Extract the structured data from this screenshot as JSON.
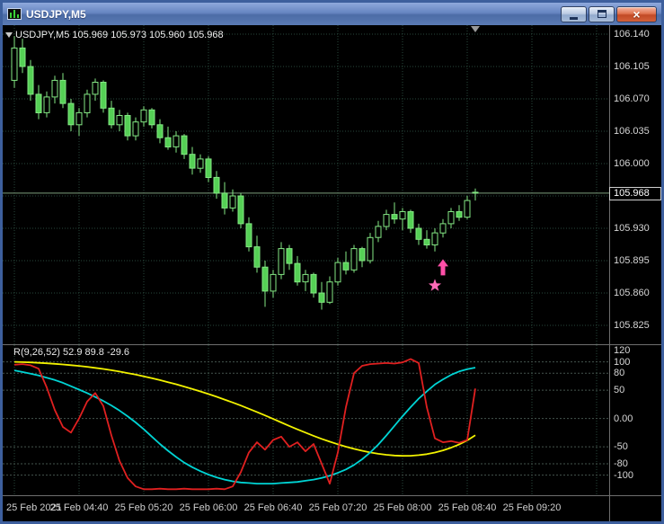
{
  "window": {
    "title": "USDJPY,M5",
    "close_glyph": "×"
  },
  "colors": {
    "background": "#000000",
    "grid": "#29493b",
    "level_line": "#45544d",
    "candle_border": "#84e884",
    "bull_fill": "#000000",
    "bear_fill": "#55d055",
    "price_line": "#7e9e7e",
    "axis_text": "#d6d6d6",
    "shift_marker": "#9a9a9a"
  },
  "chart_data": {
    "type": "candlestick",
    "symbol": "USDJPY",
    "timeframe": "M5",
    "ohlc_header": "USDJPY,M5 105.969 105.973 105.960 105.968",
    "open": 105.969,
    "high": 105.973,
    "low": 105.96,
    "close": 105.968,
    "current_price": 105.968,
    "price_tag": "105.968",
    "price_axis": {
      "max": 106.14,
      "min": 105.805,
      "step": 0.035,
      "labels": [
        {
          "value": 106.14,
          "text": "106.140"
        },
        {
          "value": 106.105,
          "text": "106.105"
        },
        {
          "value": 106.07,
          "text": "106.070"
        },
        {
          "value": 106.035,
          "text": "106.035"
        },
        {
          "value": 106.0,
          "text": "106.000"
        },
        {
          "value": 105.93,
          "text": "105.930"
        },
        {
          "value": 105.895,
          "text": "105.895"
        },
        {
          "value": 105.86,
          "text": "105.860"
        },
        {
          "value": 105.825,
          "text": "105.825"
        }
      ],
      "grid_levels": [
        106.14,
        106.105,
        106.07,
        106.035,
        106.0,
        105.965,
        105.93,
        105.895,
        105.86,
        105.825
      ]
    },
    "time_axis": {
      "labels": [
        {
          "bar": 0,
          "text": "25 Feb 2021"
        },
        {
          "bar": 8,
          "text": "25 Feb 04:40"
        },
        {
          "bar": 16,
          "text": "25 Feb 05:20"
        },
        {
          "bar": 24,
          "text": "25 Feb 06:00"
        },
        {
          "bar": 32,
          "text": "25 Feb 06:40"
        },
        {
          "bar": 40,
          "text": "25 Feb 07:20"
        },
        {
          "bar": 48,
          "text": "25 Feb 08:00"
        },
        {
          "bar": 56,
          "text": "25 Feb 08:40"
        },
        {
          "bar": 64,
          "text": "25 Feb 09:20"
        }
      ],
      "grid_bars": [
        0,
        8,
        16,
        24,
        32,
        40,
        48,
        56,
        64,
        72
      ]
    },
    "candles": [
      [
        106.09,
        106.138,
        106.082,
        106.125
      ],
      [
        106.125,
        106.135,
        106.098,
        106.105
      ],
      [
        106.105,
        106.112,
        106.068,
        106.075
      ],
      [
        106.075,
        106.085,
        106.048,
        106.055
      ],
      [
        106.055,
        106.078,
        106.05,
        106.072
      ],
      [
        106.072,
        106.095,
        106.065,
        106.09
      ],
      [
        106.09,
        106.098,
        106.06,
        106.065
      ],
      [
        106.065,
        106.07,
        106.035,
        106.042
      ],
      [
        106.042,
        106.06,
        106.03,
        106.055
      ],
      [
        106.055,
        106.08,
        106.05,
        106.075
      ],
      [
        106.075,
        106.092,
        106.068,
        106.088
      ],
      [
        106.088,
        106.09,
        106.055,
        106.06
      ],
      [
        106.06,
        106.068,
        106.038,
        106.042
      ],
      [
        106.042,
        106.058,
        106.035,
        106.052
      ],
      [
        106.052,
        106.055,
        106.025,
        106.03
      ],
      [
        106.03,
        106.05,
        106.025,
        106.045
      ],
      [
        106.045,
        106.062,
        106.04,
        106.058
      ],
      [
        106.058,
        106.06,
        106.038,
        106.042
      ],
      [
        106.042,
        106.048,
        106.022,
        106.028
      ],
      [
        106.028,
        106.04,
        106.015,
        106.018
      ],
      [
        106.018,
        106.035,
        106.012,
        106.03
      ],
      [
        106.03,
        106.032,
        106.005,
        106.01
      ],
      [
        106.01,
        106.018,
        105.988,
        105.995
      ],
      [
        105.995,
        106.01,
        105.99,
        106.005
      ],
      [
        106.005,
        106.008,
        105.98,
        105.985
      ],
      [
        105.985,
        105.992,
        105.962,
        105.968
      ],
      [
        105.968,
        105.98,
        105.945,
        105.952
      ],
      [
        105.952,
        105.972,
        105.948,
        105.965
      ],
      [
        105.965,
        105.968,
        105.93,
        105.935
      ],
      [
        105.935,
        105.942,
        105.905,
        105.91
      ],
      [
        105.91,
        105.922,
        105.882,
        105.888
      ],
      [
        105.888,
        105.895,
        105.845,
        105.862
      ],
      [
        105.862,
        105.885,
        105.855,
        105.88
      ],
      [
        105.88,
        105.915,
        105.875,
        105.908
      ],
      [
        105.908,
        105.912,
        105.885,
        105.892
      ],
      [
        105.892,
        105.9,
        105.868,
        105.872
      ],
      [
        105.872,
        105.885,
        105.862,
        105.88
      ],
      [
        105.88,
        105.882,
        105.855,
        105.86
      ],
      [
        105.86,
        105.872,
        105.842,
        105.85
      ],
      [
        105.85,
        105.878,
        105.848,
        105.872
      ],
      [
        105.872,
        105.898,
        105.868,
        105.893
      ],
      [
        105.893,
        105.905,
        105.88,
        105.885
      ],
      [
        105.885,
        105.912,
        105.882,
        105.908
      ],
      [
        105.908,
        105.91,
        105.888,
        105.895
      ],
      [
        105.895,
        105.925,
        105.892,
        105.92
      ],
      [
        105.92,
        105.938,
        105.915,
        105.932
      ],
      [
        105.932,
        105.95,
        105.928,
        105.945
      ],
      [
        105.945,
        105.958,
        105.935,
        105.94
      ],
      [
        105.94,
        105.952,
        105.928,
        105.948
      ],
      [
        105.948,
        105.95,
        105.925,
        105.93
      ],
      [
        105.93,
        105.935,
        105.912,
        105.918
      ],
      [
        105.918,
        105.928,
        105.908,
        105.912
      ],
      [
        105.912,
        105.93,
        105.905,
        105.925
      ],
      [
        105.925,
        105.94,
        105.92,
        105.935
      ],
      [
        105.935,
        105.952,
        105.93,
        105.948
      ],
      [
        105.948,
        105.955,
        105.938,
        105.942
      ],
      [
        105.942,
        105.965,
        105.94,
        105.96
      ],
      [
        105.969,
        105.973,
        105.96,
        105.968
      ]
    ],
    "markers": [
      {
        "type": "arrow-up",
        "bar": 53,
        "price": 105.88,
        "color": "#ff4fa8",
        "name": "buy-arrow-marker"
      },
      {
        "type": "star",
        "bar": 52,
        "price": 105.868,
        "color": "#ff6ab8",
        "name": "star-marker"
      }
    ],
    "indicator": {
      "header": "R(9,26,52) 52.9 89.8 -29.6",
      "name": "R",
      "params": [
        9,
        26,
        52
      ],
      "current_values": [
        52.9,
        89.8,
        -29.6
      ],
      "axis": {
        "labels": [
          {
            "value": 120,
            "text": "120"
          },
          {
            "value": 100,
            "text": "100"
          },
          {
            "value": 80,
            "text": "80"
          },
          {
            "value": 50,
            "text": "50"
          },
          {
            "value": 0,
            "text": "0.00"
          },
          {
            "value": -50,
            "text": "-50"
          },
          {
            "value": -80,
            "text": "-80"
          },
          {
            "value": -100,
            "text": "-100"
          }
        ],
        "level_lines": [
          100,
          80,
          50,
          0,
          -50,
          -80,
          -100
        ],
        "range": [
          120,
          -135
        ]
      },
      "series": [
        {
          "name": "fast-9",
          "color": "#e02020",
          "values": [
            95,
            96,
            94,
            88,
            55,
            15,
            -15,
            -25,
            0,
            30,
            45,
            22,
            -30,
            -75,
            -105,
            -120,
            -125,
            -125,
            -124,
            -125,
            -125,
            -124,
            -125,
            -125,
            -125,
            -124,
            -125,
            -120,
            -95,
            -60,
            -42,
            -55,
            -38,
            -32,
            -50,
            -42,
            -58,
            -45,
            -80,
            -115,
            -60,
            20,
            80,
            93,
            96,
            97,
            98,
            97,
            99,
            105,
            98,
            20,
            -35,
            -42,
            -40,
            -43,
            -38,
            52.9
          ]
        },
        {
          "name": "mid-26",
          "color": "#00d4d4",
          "values": [
            85,
            82,
            79,
            76,
            72,
            68,
            63,
            57,
            51,
            45,
            38,
            31,
            23,
            14,
            4,
            -7,
            -19,
            -32,
            -45,
            -57,
            -68,
            -78,
            -86,
            -93,
            -99,
            -104,
            -108,
            -111,
            -113,
            -114,
            -115,
            -115,
            -115,
            -114,
            -113,
            -112,
            -110,
            -108,
            -105,
            -101,
            -96,
            -90,
            -82,
            -72,
            -60,
            -46,
            -30,
            -13,
            4,
            20,
            35,
            48,
            60,
            69,
            77,
            83,
            87,
            89.8
          ]
        },
        {
          "name": "slow-52",
          "color": "#f2f200",
          "values": [
            100,
            99.5,
            99,
            98.3,
            97.5,
            96.5,
            95.4,
            94.2,
            92.8,
            91.2,
            89.4,
            87.4,
            85.2,
            82.8,
            80.2,
            77.4,
            74.4,
            71.2,
            67.8,
            64.2,
            60.4,
            56.4,
            52.2,
            47.8,
            43.2,
            38.4,
            33.4,
            28.2,
            22.8,
            17.2,
            11.4,
            5.4,
            -0.8,
            -7,
            -13.2,
            -19.2,
            -25,
            -30.6,
            -36,
            -41,
            -45.6,
            -49.8,
            -53.6,
            -57,
            -60,
            -62.4,
            -64.2,
            -65.4,
            -66,
            -65.8,
            -64.8,
            -63,
            -60.2,
            -56.4,
            -51.6,
            -45.8,
            -38.8,
            -29.6
          ]
        }
      ]
    }
  }
}
